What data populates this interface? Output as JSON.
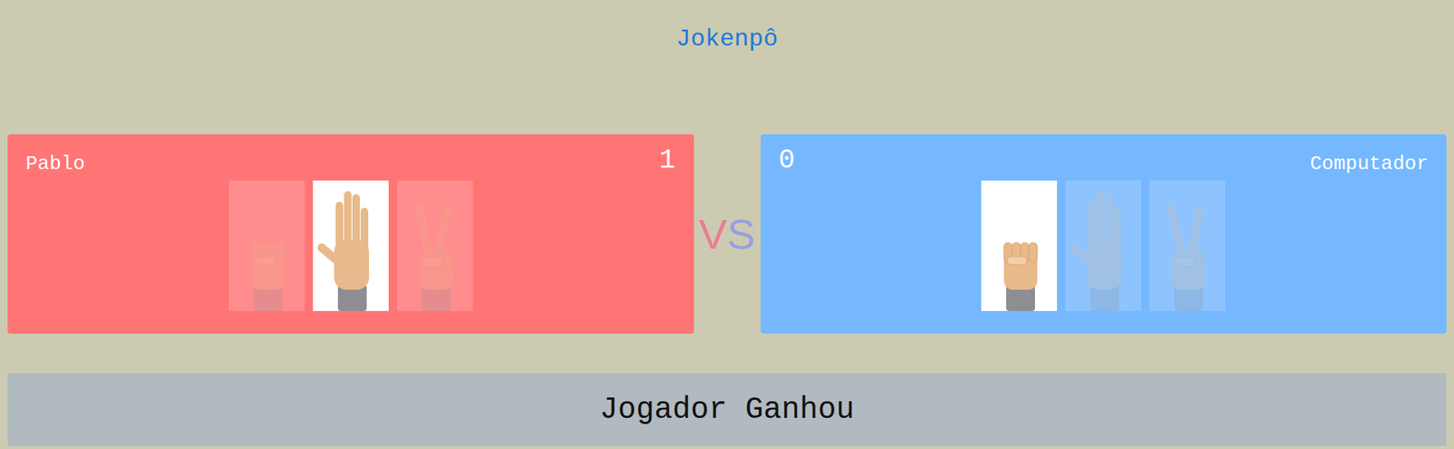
{
  "title": "Jokenpô",
  "player": {
    "name": "Pablo",
    "score": "1",
    "choices": [
      {
        "kind": "rock",
        "selected": false
      },
      {
        "kind": "paper",
        "selected": true
      },
      {
        "kind": "scissors",
        "selected": false
      }
    ]
  },
  "vs": "VS",
  "computer": {
    "name": "Computador",
    "score": "0",
    "choices": [
      {
        "kind": "rock",
        "selected": true
      },
      {
        "kind": "paper",
        "selected": false
      },
      {
        "kind": "scissors",
        "selected": false
      }
    ]
  },
  "result": "Jogador Ganhou"
}
